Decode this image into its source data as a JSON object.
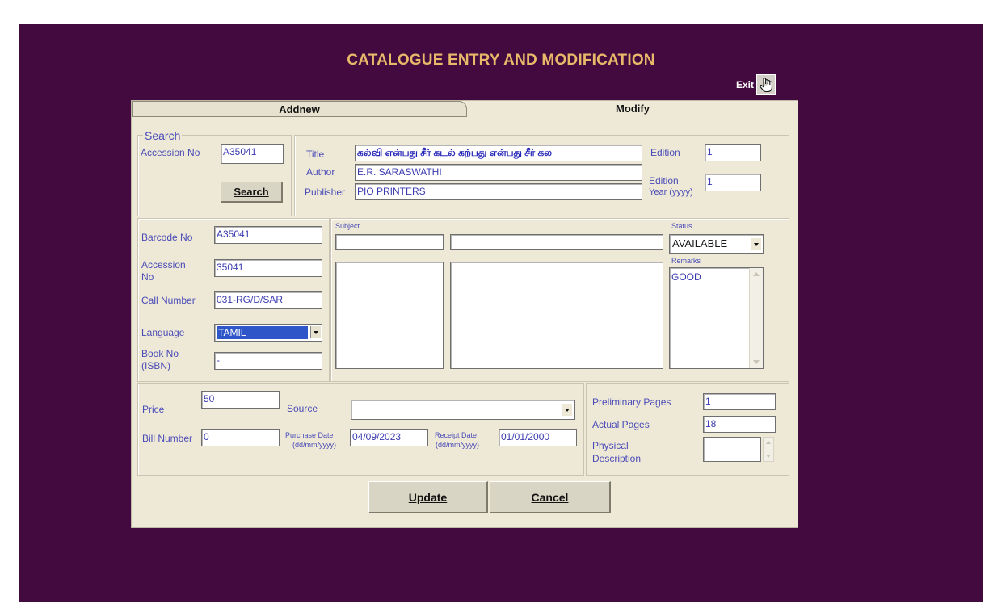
{
  "window": {
    "title": "CATALOGUE ENTRY AND MODIFICATION",
    "exit_label": "Exit",
    "exit_icon": "hand-pointer-icon"
  },
  "tabs": [
    {
      "label": "Addnew"
    },
    {
      "label": "Modify"
    }
  ],
  "search": {
    "group_label": "Search",
    "accession_label": "Accession No",
    "accession_value": "A35041",
    "button_label": "Search"
  },
  "book": {
    "title_label": "Title",
    "title_value": "கல்வி என்பது சீர் கடல் கற்பது என்பது சீர் கல",
    "author_label": "Author",
    "author_value": "E.R. SARASWATHI",
    "publisher_label": "Publisher",
    "publisher_value": "PIO PRINTERS",
    "edition_label": "Edition",
    "edition_value": "1",
    "edition_year_label": "Edition",
    "edition_year_label2": "Year (yyyy)",
    "edition_year_value": "1"
  },
  "details": {
    "barcode_label": "Barcode No",
    "barcode_value": "A35041",
    "accession_label": "Accession",
    "accession_label2": "No",
    "accession_value": "35041",
    "call_number_label": "Call Number",
    "call_number_value": "031-RG/D/SAR",
    "language_label": "Language",
    "language_value": "TAMIL",
    "book_no_label": "Book No",
    "book_no_label2": "(ISBN)",
    "book_no_value": "-"
  },
  "subject": {
    "label": "Subject",
    "code_value": "",
    "name_value": "",
    "list_left": "",
    "list_right": ""
  },
  "status": {
    "label": "Status",
    "value": "AVAILABLE",
    "remarks_label": "Remarks",
    "remarks_value": "GOOD"
  },
  "purchase": {
    "price_label": "Price",
    "price_value": "50",
    "source_label": "Source",
    "source_value": "",
    "bill_label": "Bill Number",
    "bill_value": "0",
    "purchase_date_label": "Purchase Date",
    "purchase_date_format": "(dd/mm/yyyy)",
    "purchase_date_value": "04/09/2023",
    "receipt_date_label": "Receipt Date",
    "receipt_date_format": "(dd/mm/yyyy)",
    "receipt_date_value": "01/01/2000"
  },
  "pages": {
    "preliminary_label": "Preliminary Pages",
    "preliminary_value": "1",
    "actual_label": "Actual Pages",
    "actual_value": "18",
    "physical_label": "Physical",
    "physical_label2": "Description",
    "physical_value": ""
  },
  "actions": {
    "update_label": "Update",
    "cancel_label": "Cancel"
  },
  "colors": {
    "background": "#420a3f",
    "title": "#e9b96a",
    "panel": "#ede9d6",
    "label": "#4b4bb8",
    "selection": "#2f56c8"
  }
}
